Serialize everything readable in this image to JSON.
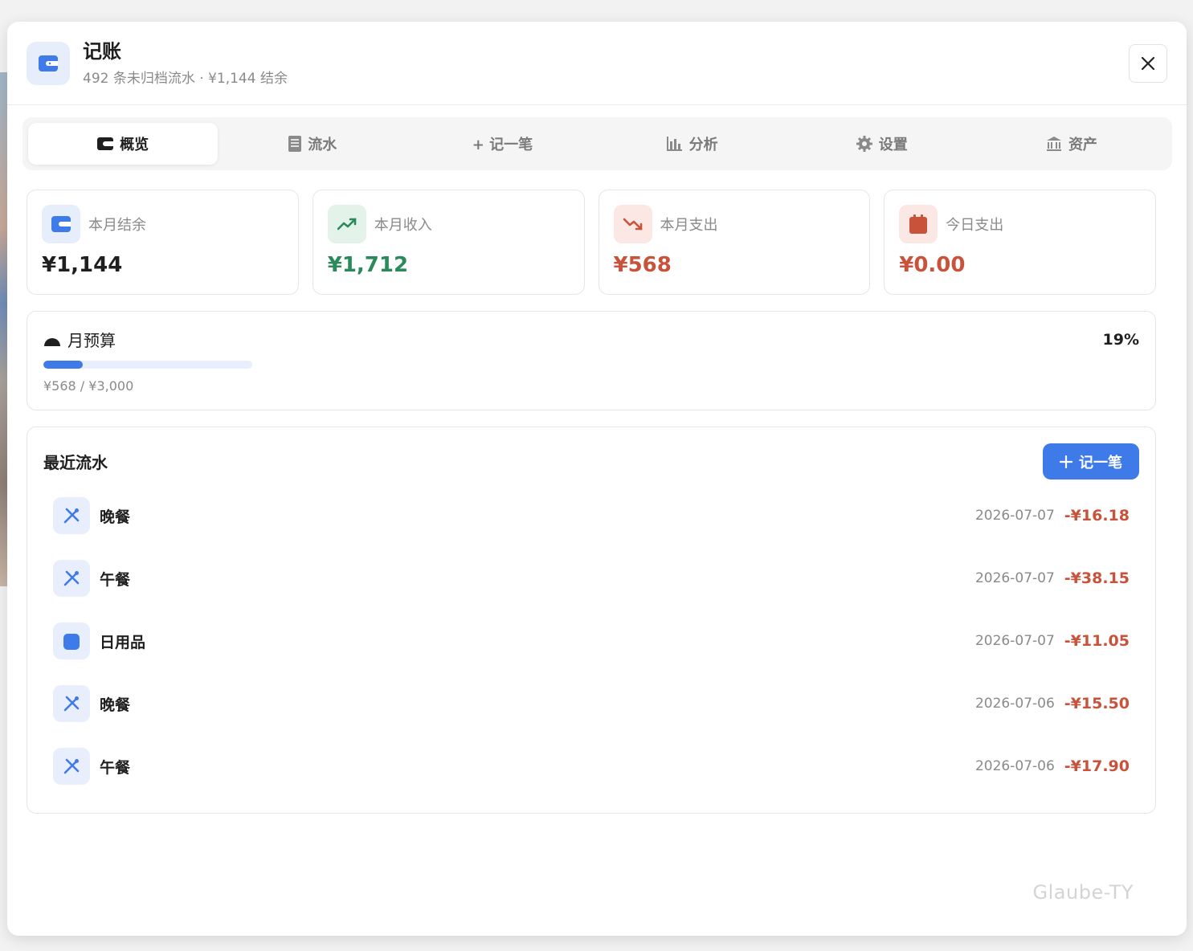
{
  "header": {
    "title": "记账",
    "subtitle": "492 条未归档流水 · ¥1,144 结余"
  },
  "tabs": [
    {
      "label": "概览",
      "icon": "wallet-icon",
      "active": true
    },
    {
      "label": "流水",
      "icon": "ledger-icon",
      "active": false
    },
    {
      "label": "+ 记一笔",
      "icon": "plus-icon",
      "active": false
    },
    {
      "label": "分析",
      "icon": "bar-chart-icon",
      "active": false
    },
    {
      "label": "设置",
      "icon": "gear-icon",
      "active": false
    },
    {
      "label": "资产",
      "icon": "bank-icon",
      "active": false
    }
  ],
  "stats": [
    {
      "label": "本月结余",
      "value": "¥1,144",
      "icon": "wallet-icon",
      "color": "#1f1f1f",
      "icon_bg": "#e6eefb",
      "icon_color": "#3f7be8"
    },
    {
      "label": "本月收入",
      "value": "¥1,712",
      "icon": "trend-up-icon",
      "color": "#2a8a5a",
      "icon_bg": "#e3f3ea",
      "icon_color": "#2a8a5a"
    },
    {
      "label": "本月支出",
      "value": "¥568",
      "icon": "trend-down-icon",
      "color": "#c9523a",
      "icon_bg": "#fbe8e4",
      "icon_color": "#c9523a"
    },
    {
      "label": "今日支出",
      "value": "¥0.00",
      "icon": "calendar-icon",
      "color": "#c9523a",
      "icon_bg": "#fbe8e4",
      "icon_color": "#c9523a"
    }
  ],
  "budget": {
    "title": "月预算",
    "percent_label": "19%",
    "progress": 0.19,
    "amount": "¥568 / ¥3,000",
    "bar_color": "#3f7be8"
  },
  "recent": {
    "title": "最近流水",
    "add_label": "记一笔",
    "rows": [
      {
        "name": "晚餐",
        "date": "2026-07-07",
        "amount": "-¥16.18",
        "icon": "utensils-icon"
      },
      {
        "name": "午餐",
        "date": "2026-07-07",
        "amount": "-¥38.15",
        "icon": "utensils-icon"
      },
      {
        "name": "日用品",
        "date": "2026-07-07",
        "amount": "-¥11.05",
        "icon": "bag-icon"
      },
      {
        "name": "晚餐",
        "date": "2026-07-06",
        "amount": "-¥15.50",
        "icon": "utensils-icon"
      },
      {
        "name": "午餐",
        "date": "2026-07-06",
        "amount": "-¥17.90",
        "icon": "utensils-icon"
      }
    ]
  },
  "watermark": "Glaube-TY"
}
